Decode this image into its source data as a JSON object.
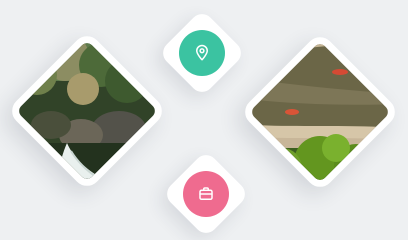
{
  "cards": {
    "waterfall": {
      "kind": "photo",
      "subject": "waterfall-forest"
    },
    "river": {
      "kind": "photo",
      "subject": "river-rafting"
    },
    "location": {
      "kind": "icon-button",
      "icon": "location-pin-icon",
      "color": "#3bc3a1"
    },
    "bag": {
      "kind": "icon-button",
      "icon": "bag-icon",
      "color": "#ef6b8f"
    }
  },
  "colors": {
    "background": "#eef0f2",
    "card_surface": "#ffffff",
    "accent_green": "#3bc3a1",
    "accent_pink": "#ef6b8f"
  }
}
